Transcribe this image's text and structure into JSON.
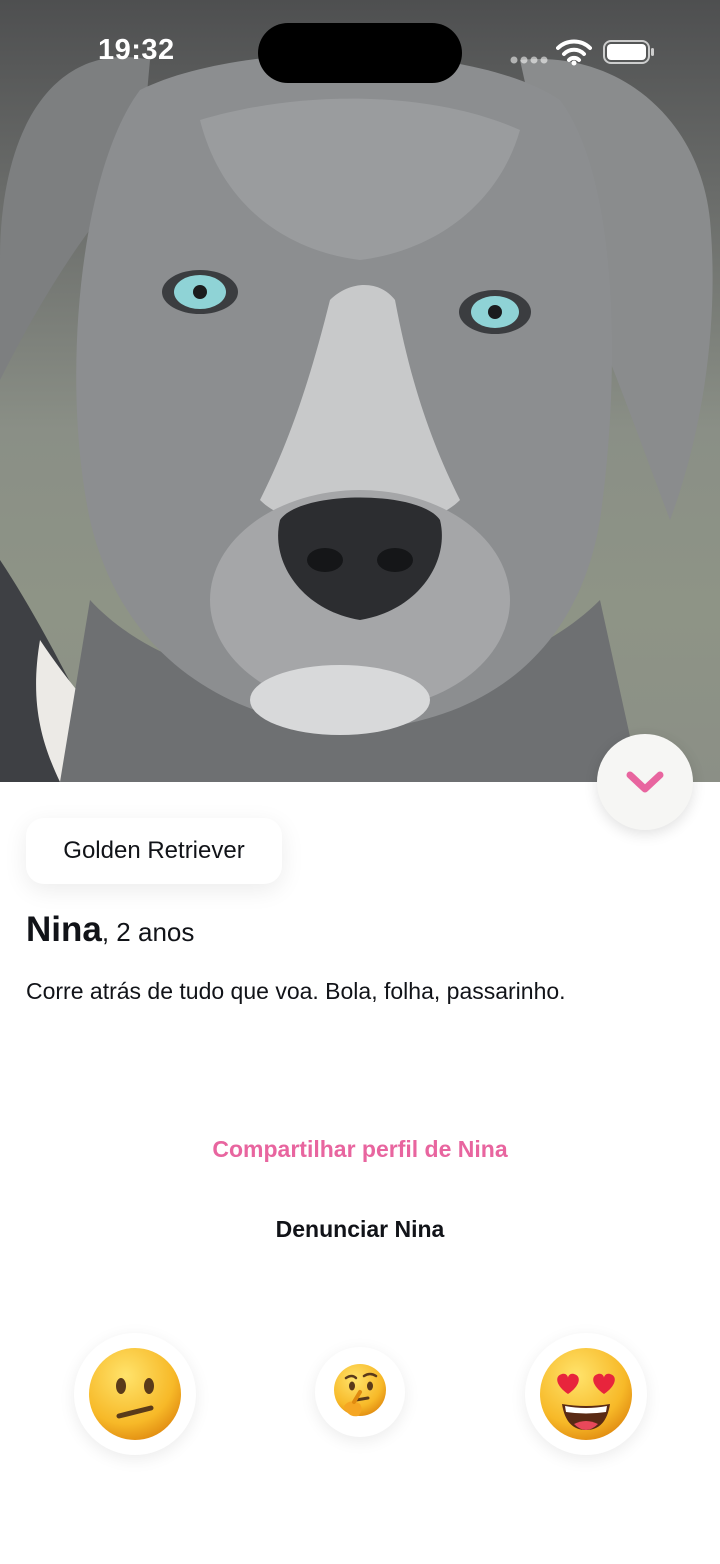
{
  "status_bar": {
    "time": "19:32"
  },
  "hero": {
    "image_subject": "gray dog photo"
  },
  "profile": {
    "breed": "Golden Retriever",
    "name": "Nina",
    "age": ", 2 anos",
    "bio": "Corre atrás de tudo que voa. Bola, folha, passarinho."
  },
  "actions": {
    "share": "Compartilhar perfil de Nina",
    "report": "Denunciar Nina"
  },
  "reactions": [
    "confused-face",
    "thinking-face",
    "heart-eyes-face"
  ],
  "colors": {
    "accent": "#e8659f",
    "text": "#111318"
  }
}
